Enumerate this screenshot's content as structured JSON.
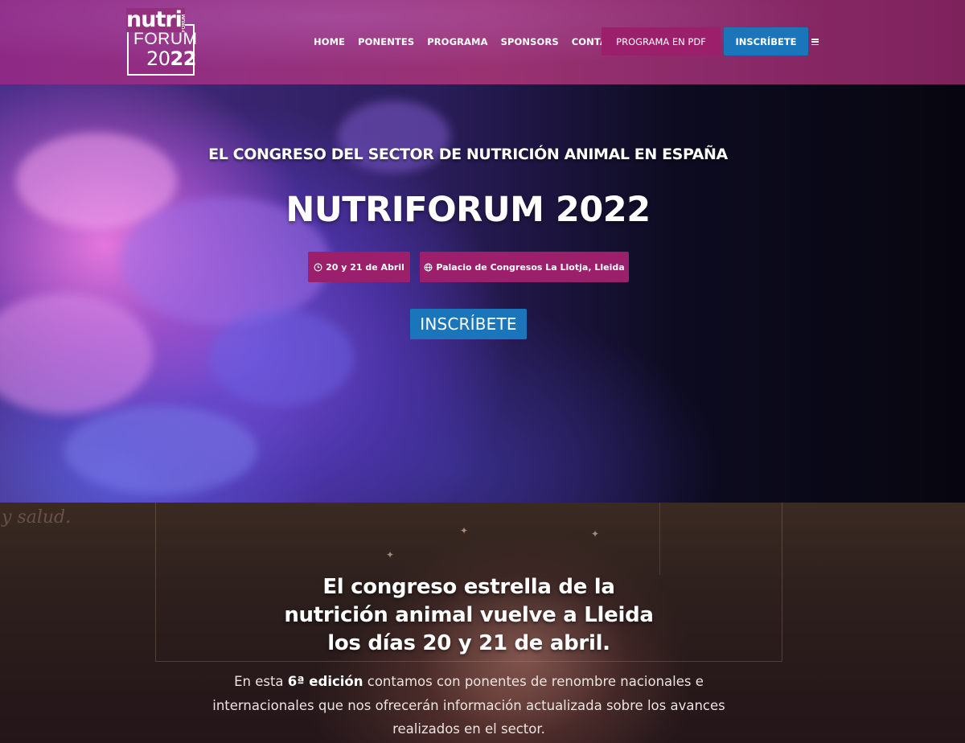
{
  "header": {
    "logo": {
      "line1": "nutri",
      "tag": "FORUM",
      "line2": "FORUM",
      "year_light": "20",
      "year_bold": "22"
    },
    "nav": [
      "HOME",
      "PONENTES",
      "PROGRAMA",
      "SPONSORS",
      "CONTACTO"
    ],
    "pdf_button": "PROGRAMA EN PDF",
    "register_button": "INSCRÍBETE",
    "menu_icon": "hamburger-icon"
  },
  "hero": {
    "kicker": "EL CONGRESO DEL SECTOR DE NUTRICIÓN ANIMAL EN ESPAÑA",
    "title": "NUTRIFORUM 2022",
    "date": "20 y 21 de Abril",
    "date_icon": "clock-icon",
    "venue": "Palacio de Congresos La Llotja, Lleida",
    "venue_icon": "globe-icon",
    "register_button": "INSCRÍBETE"
  },
  "intro": {
    "background_script": "y salud.",
    "title": "El congreso estrella de la nutrición animal vuelve a Lleida los días 20 y 21 de abril.",
    "text_before": "En esta ",
    "text_bold": "6ª edición",
    "text_after": " contamos con ponentes de renombre nacionales e internacionales que nos ofrecerán información actualizada sobre los avances realizados en el sector."
  },
  "colors": {
    "header": "#93307f",
    "magenta_button": "#9b1f6b",
    "blue_button": "#1b75bb"
  }
}
